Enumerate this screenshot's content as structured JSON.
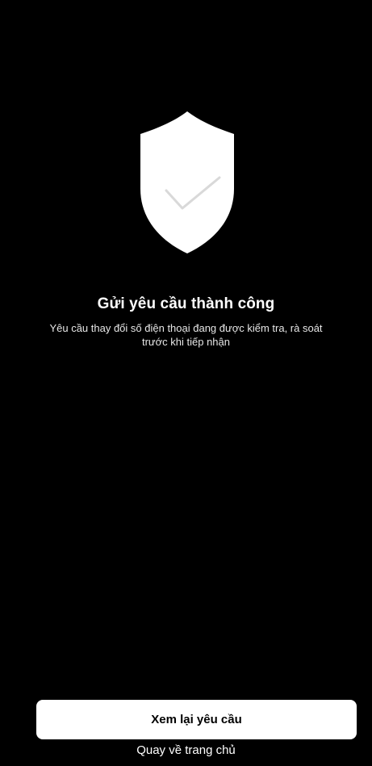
{
  "screen": {
    "background": "#000000",
    "icon": "shield-check-icon",
    "title": "Gửi yêu cầu thành công",
    "description_line1": "Yêu cầu thay đổi số điện thoại đang được kiểm tra, rà soát",
    "description_line2": "trước khi tiếp nhận"
  },
  "actions": {
    "review_label": "Xem lại yêu cầu",
    "home_label": "Quay về trang chủ"
  }
}
